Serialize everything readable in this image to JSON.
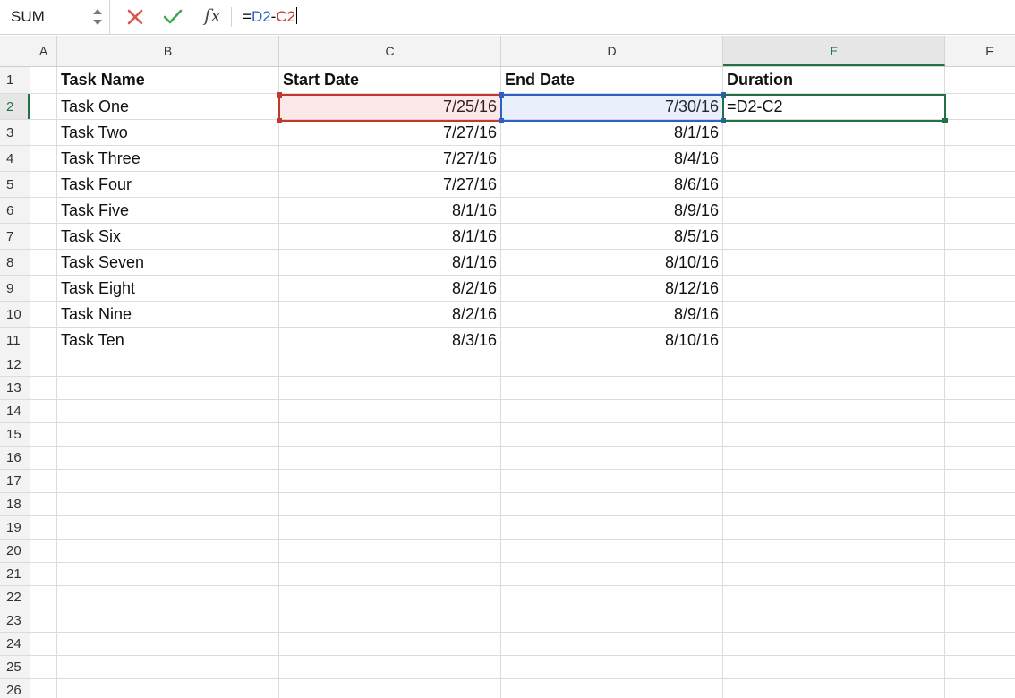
{
  "formula_bar": {
    "name_box": "SUM",
    "cancel_icon": "x-icon",
    "confirm_icon": "check-icon",
    "fx_label": "fx",
    "formula_prefix": "=",
    "formula_ref1": "D2",
    "formula_op": "-",
    "formula_ref2": "C2"
  },
  "columns": [
    "A",
    "B",
    "C",
    "D",
    "E",
    "F"
  ],
  "active_column": "E",
  "active_row": "2",
  "header_row": {
    "row_num": "1",
    "task_name": "Task Name",
    "start_date": "Start Date",
    "end_date": "End Date",
    "duration": "Duration"
  },
  "rows": [
    {
      "num": "2",
      "task": "Task One",
      "start": "7/25/16",
      "end": "7/30/16",
      "duration": "=D2-C2"
    },
    {
      "num": "3",
      "task": "Task Two",
      "start": "7/27/16",
      "end": "8/1/16",
      "duration": ""
    },
    {
      "num": "4",
      "task": "Task Three",
      "start": "7/27/16",
      "end": "8/4/16",
      "duration": ""
    },
    {
      "num": "5",
      "task": "Task Four",
      "start": "7/27/16",
      "end": "8/6/16",
      "duration": ""
    },
    {
      "num": "6",
      "task": "Task Five",
      "start": "8/1/16",
      "end": "8/9/16",
      "duration": ""
    },
    {
      "num": "7",
      "task": "Task Six",
      "start": "8/1/16",
      "end": "8/5/16",
      "duration": ""
    },
    {
      "num": "8",
      "task": "Task Seven",
      "start": "8/1/16",
      "end": "8/10/16",
      "duration": ""
    },
    {
      "num": "9",
      "task": "Task Eight",
      "start": "8/2/16",
      "end": "8/12/16",
      "duration": ""
    },
    {
      "num": "10",
      "task": "Task Nine",
      "start": "8/2/16",
      "end": "8/9/16",
      "duration": ""
    },
    {
      "num": "11",
      "task": "Task Ten",
      "start": "8/3/16",
      "end": "8/10/16",
      "duration": ""
    }
  ],
  "empty_rows": [
    "12",
    "13",
    "14",
    "15",
    "16",
    "17",
    "18",
    "19",
    "20",
    "21",
    "22",
    "23",
    "24",
    "25",
    "26"
  ],
  "colors": {
    "ref_c": "#c0392b",
    "ref_d": "#2f5ec4",
    "active": "#217346"
  }
}
